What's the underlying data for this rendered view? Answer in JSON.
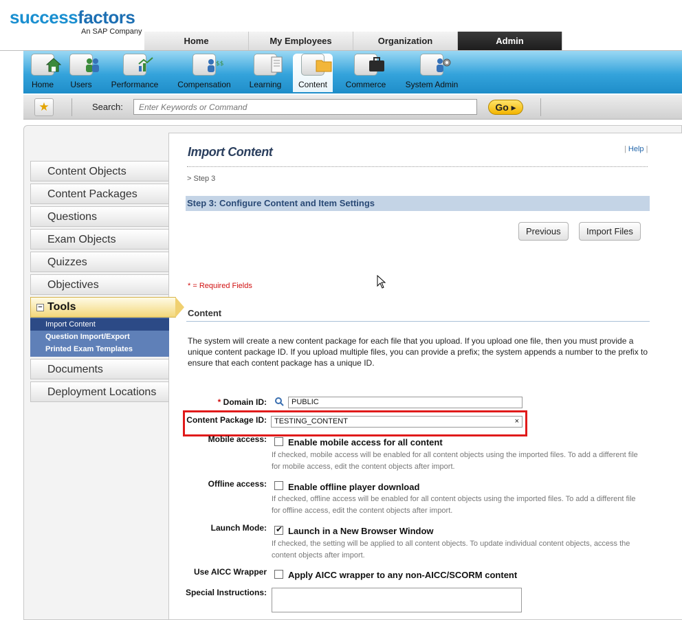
{
  "brand": {
    "name_part1": "success",
    "name_part2": "factors",
    "tagline": "An SAP Company"
  },
  "top_nav": [
    {
      "label": "Home",
      "active": false
    },
    {
      "label": "My Employees",
      "active": false
    },
    {
      "label": "Organization",
      "active": false
    },
    {
      "label": "Admin",
      "active": true
    }
  ],
  "modules": [
    {
      "label": "Home",
      "icon": "home-icon"
    },
    {
      "label": "Users",
      "icon": "users-icon"
    },
    {
      "label": "Performance",
      "icon": "performance-icon"
    },
    {
      "label": "Compensation",
      "icon": "compensation-icon"
    },
    {
      "label": "Learning",
      "icon": "learning-icon"
    },
    {
      "label": "Content",
      "icon": "content-folder-icon",
      "active": true
    },
    {
      "label": "Commerce",
      "icon": "commerce-briefcase-icon"
    },
    {
      "label": "System Admin",
      "icon": "system-admin-icon"
    }
  ],
  "search": {
    "label": "Search:",
    "placeholder": "Enter Keywords or Command",
    "go_label": "Go"
  },
  "left_nav": {
    "items_top": [
      "Content Objects",
      "Content Packages",
      "Questions",
      "Exam Objects",
      "Quizzes",
      "Objectives"
    ],
    "tools": {
      "label": "Tools",
      "collapse_symbol": "−",
      "sub_items": [
        "Import Content",
        "Question Import/Export",
        "Printed Exam Templates"
      ],
      "active_sub": "Import Content"
    },
    "items_bottom": [
      "Documents",
      "Deployment Locations"
    ]
  },
  "page": {
    "title": "Import Content",
    "help_label": "Help",
    "help_sep": "|",
    "breadcrumb": "> Step 3",
    "step_header": "Step 3: Configure Content and Item Settings",
    "buttons": {
      "previous": "Previous",
      "import_files": "Import Files"
    },
    "required_note": "* = Required Fields",
    "section_title": "Content",
    "description": "The system will create a new content package for each file that you upload. If you upload one file, then you must provide a unique content package ID. If you upload multiple files, you can provide a prefix; the system appends a number to the prefix to ensure that each content package has a unique ID."
  },
  "form": {
    "domain_id": {
      "label": "Domain ID:",
      "required_mark": "*",
      "value": "PUBLIC"
    },
    "content_package_id": {
      "label": "Content Package ID:",
      "value": "TESTING_CONTENT",
      "clear_symbol": "×"
    },
    "mobile_access": {
      "label": "Mobile access:",
      "checkbox_label": "Enable mobile access for all content",
      "checked": false,
      "hint": "If checked, mobile access will be enabled for all content objects using the imported files. To add a different file for mobile access, edit the content objects after import."
    },
    "offline_access": {
      "label": "Offline access:",
      "checkbox_label": "Enable offline player download",
      "checked": false,
      "hint": "If checked, offline access will be enabled for all content objects using the imported files. To add a different file for offline access, edit the content objects after import."
    },
    "launch_mode": {
      "label": "Launch Mode:",
      "checkbox_label": "Launch in a New Browser Window",
      "checked": true,
      "hint": "If checked, the setting will be applied to all content objects. To update individual content objects, access the content objects after import."
    },
    "aicc_wrapper": {
      "label": "Use AICC Wrapper",
      "checkbox_label": "Apply AICC wrapper to any non-AICC/SCORM content",
      "checked": false
    },
    "special_instructions": {
      "label": "Special Instructions:",
      "value": ""
    }
  },
  "colors": {
    "brand_blue": "#1a8fd0",
    "module_bar": "#34a3db",
    "active_tab": "#1c1c1c",
    "step_header_bg": "#c4d4e6",
    "highlight_red": "#e01a1a",
    "required_red": "#d01010",
    "sub_nav_blue": "#5f80b8"
  }
}
